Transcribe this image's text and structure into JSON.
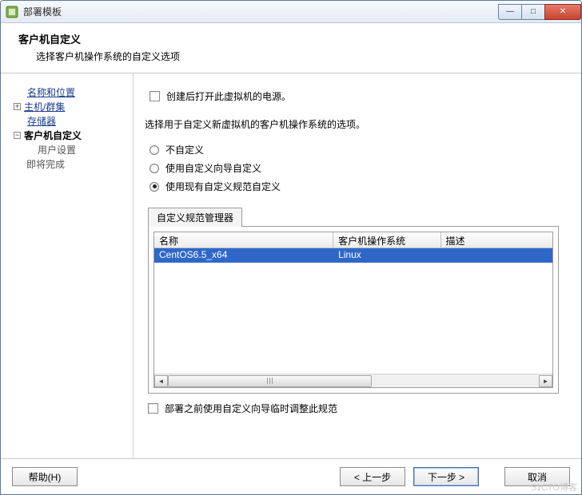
{
  "window": {
    "title": "部署模板",
    "buttons": {
      "minimize": "—",
      "maximize": "□",
      "close": "✕"
    }
  },
  "header": {
    "title": "客户机自定义",
    "subtitle": "选择客户机操作系统的自定义选项"
  },
  "sidebar": {
    "items": [
      {
        "label": "名称和位置",
        "link": true,
        "expand": null
      },
      {
        "label": "主机/群集",
        "link": true,
        "expand": "plus"
      },
      {
        "label": "存储器",
        "link": true,
        "expand": null
      },
      {
        "label": "客户机自定义",
        "link": false,
        "expand": "minus",
        "current": true
      },
      {
        "label": "用户设置",
        "link": false,
        "sub": true
      },
      {
        "label": "即将完成",
        "link": false
      }
    ]
  },
  "content": {
    "power_on_label": "创建后打开此虚拟机的电源。",
    "prompt": "选择用于自定义新虚拟机的客户机操作系统的选项。",
    "radios": {
      "none": "不自定义",
      "wizard": "使用自定义向导自定义",
      "existing": "使用现有自定义规范自定义"
    },
    "tab_label": "自定义规范管理器",
    "table": {
      "headers": {
        "name": "名称",
        "os": "客户机操作系统",
        "desc": "描述"
      },
      "rows": [
        {
          "name": "CentOS6.5_x64",
          "os": "Linux",
          "desc": ""
        }
      ]
    },
    "adjust_label": "部署之前使用自定义向导临时调整此规范"
  },
  "footer": {
    "help": "帮助(H)",
    "back": "< 上一步",
    "next": "下一步 >",
    "cancel": "取消"
  },
  "watermark": "51CTO博客"
}
